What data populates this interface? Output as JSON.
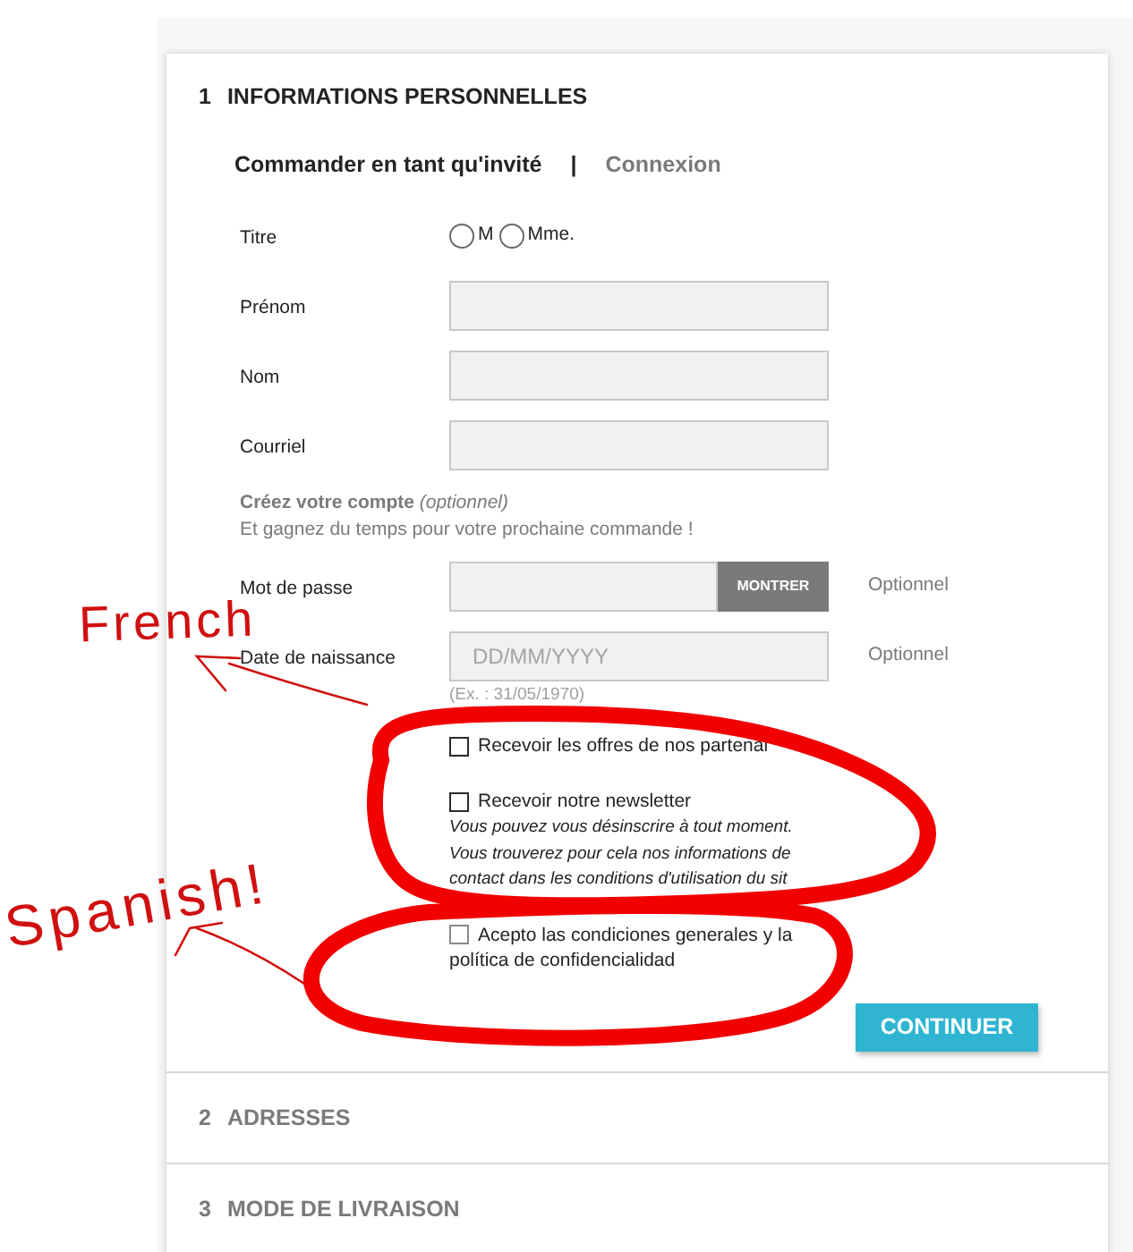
{
  "steps": [
    {
      "number": "1",
      "title": "INFORMATIONS PERSONNELLES",
      "selected": true
    },
    {
      "number": "2",
      "title": "ADRESSES",
      "selected": false
    },
    {
      "number": "3",
      "title": "MODE DE LIVRAISON",
      "selected": false
    }
  ],
  "tabs": [
    {
      "label": "Commander en tant qu'invité",
      "selected": true
    },
    {
      "label": "Connexion",
      "selected": false
    }
  ],
  "tab_separator": "|",
  "title_field": {
    "label": "Titre",
    "options": [
      {
        "label": "M",
        "selected": false
      },
      {
        "label": "Mme.",
        "selected": false
      }
    ]
  },
  "fields": [
    {
      "label": "Prénom"
    },
    {
      "label": "Nom"
    },
    {
      "label": "Courriel"
    }
  ],
  "account_note": {
    "title": "**Créez votre compte** *(optionnel)*",
    "text": "Et gagnez du temps pour votre prochaine commande !"
  },
  "password": {
    "label": "Mot de passe",
    "button": "MONTRER",
    "note": "Optionnel"
  },
  "birthdate": {
    "label": "Date de naissance",
    "placeholder": "DD/MM/YYYY",
    "note": "Optionnel",
    "hint": "(Ex. : 31/05/1970)"
  },
  "checkboxes": [
    {
      "label": "Recevoir les offres de nos partenai",
      "checked": false
    },
    {
      "label": "Recevoir notre newsletter",
      "checked": false,
      "help_lines": [
        "Vous pouvez vous désinscrire à tout moment.",
        "Vous trouverez pour cela nos informations de",
        "contact dans les conditions d'utilisation du sit"
      ]
    },
    {
      "label": "Acepto las condiciones generales y la política de confidencialidad",
      "checked": false
    }
  ],
  "submit_button": "CONTINUER",
  "annotations": [
    {
      "text": "French"
    },
    {
      "text": "Spanish!"
    }
  ]
}
